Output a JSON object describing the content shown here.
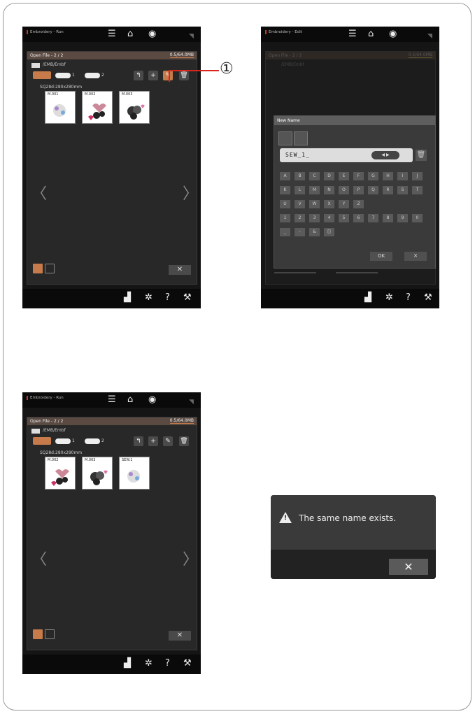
{
  "screens": {
    "run1": {
      "app_title": "Embroidery - Run",
      "panel_title": "Open File - 2 / 2",
      "storage": "0.5/64.0MB",
      "path": "/EMB/Embf",
      "usb1": "1",
      "usb2": "2",
      "hoop": "SQ28d:280x280mm",
      "files": [
        "M.001",
        "M.002",
        "M.003"
      ]
    },
    "edit": {
      "app_title": "Embroidery - Edit",
      "panel_title": "Open File - 2 / 2",
      "storage": "0.5/64.0MB",
      "path": "/EMB/Embf"
    },
    "run2": {
      "app_title": "Embroidery - Run",
      "panel_title": "Open File - 2 / 2",
      "storage": "0.5/64.0MB",
      "path": "/EMB/Embf",
      "usb1": "1",
      "usb2": "2",
      "hoop": "SQ28d:280x280mm",
      "files": [
        "M.002",
        "M.003",
        "SEW.1"
      ]
    }
  },
  "dialog": {
    "title": "New Name",
    "input_value": "SEW_1_",
    "keys": [
      "A",
      "B",
      "C",
      "D",
      "E",
      "F",
      "G",
      "H",
      "I",
      "J",
      "K",
      "L",
      "M",
      "N",
      "O",
      "P",
      "Q",
      "R",
      "S",
      "T",
      "U",
      "V",
      "W",
      "X",
      "Y",
      "Z",
      "1",
      "2",
      "3",
      "4",
      "5",
      "6",
      "7",
      "8",
      "9",
      "0",
      "_",
      "-",
      "&",
      "[]"
    ],
    "ok_label": "OK",
    "cancel_label": "✕"
  },
  "callout": {
    "number": "①"
  },
  "message": {
    "text": "The same name exists.",
    "close_label": "✕"
  },
  "common": {
    "close_label": "✕",
    "nav_prev": "〈",
    "nav_next": "〉"
  },
  "icons": {
    "menu": "menu-icon",
    "home": "home-icon",
    "wifi": "wifi-icon",
    "settings": "gear-icon",
    "help": "help-icon",
    "tools": "wrench-icon"
  },
  "colors": {
    "accent": "#c77a4a",
    "callout": "#d9261c"
  }
}
